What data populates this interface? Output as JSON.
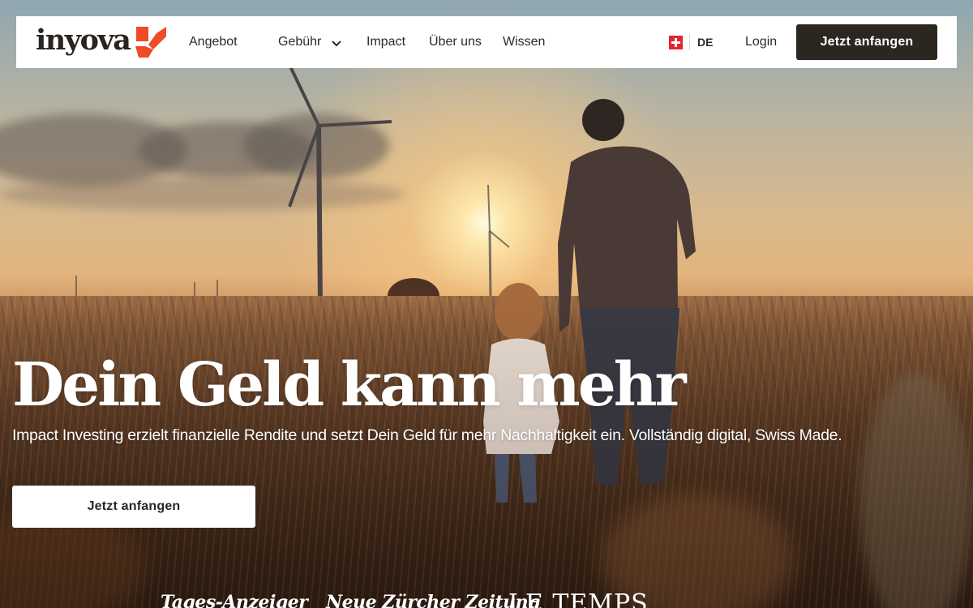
{
  "header": {
    "logo_text": "inyova",
    "nav": [
      {
        "label": "Angebot"
      },
      {
        "label": "Gebühr",
        "has_dropdown": true
      },
      {
        "label": "Impact"
      },
      {
        "label": "Über uns"
      },
      {
        "label": "Wissen"
      }
    ],
    "language": {
      "flag": "swiss-flag-icon",
      "code": "DE"
    },
    "login_label": "Login",
    "cta_label": "Jetzt anfangen"
  },
  "hero": {
    "headline": "Dein Geld kann mehr",
    "subline": "Impact Investing erzielt finanzielle Rendite und setzt Dein Geld für mehr Nachhaltigkeit ein. Vollständig digital, Swiss Made.",
    "cta_label": "Jetzt anfangen"
  },
  "press": [
    {
      "name": "Tages-Anzeiger"
    },
    {
      "name": "Neue Zürcher Zeitung"
    },
    {
      "name": "LE TEMPS"
    }
  ],
  "colors": {
    "brand_orange": "#ef4b26",
    "dark": "#2c2621",
    "white": "#ffffff"
  }
}
